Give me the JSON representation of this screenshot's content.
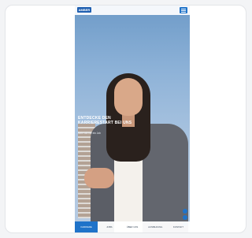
{
  "brand": {
    "logo_text": "AMBER",
    "accent": "#1f73c9"
  },
  "hero": {
    "headline": "ENTDECKE DEN KARRIERESTART BEI UNS",
    "subline": "Mehr als nur ein Job"
  },
  "bottom_nav": [
    {
      "label": "KARRIERE",
      "active": true
    },
    {
      "label": "JOBS",
      "active": false
    },
    {
      "label": "ÜBER UNS",
      "active": false
    },
    {
      "label": "AUSBILDUNG",
      "active": false
    },
    {
      "label": "KONTAKT",
      "active": false
    }
  ]
}
